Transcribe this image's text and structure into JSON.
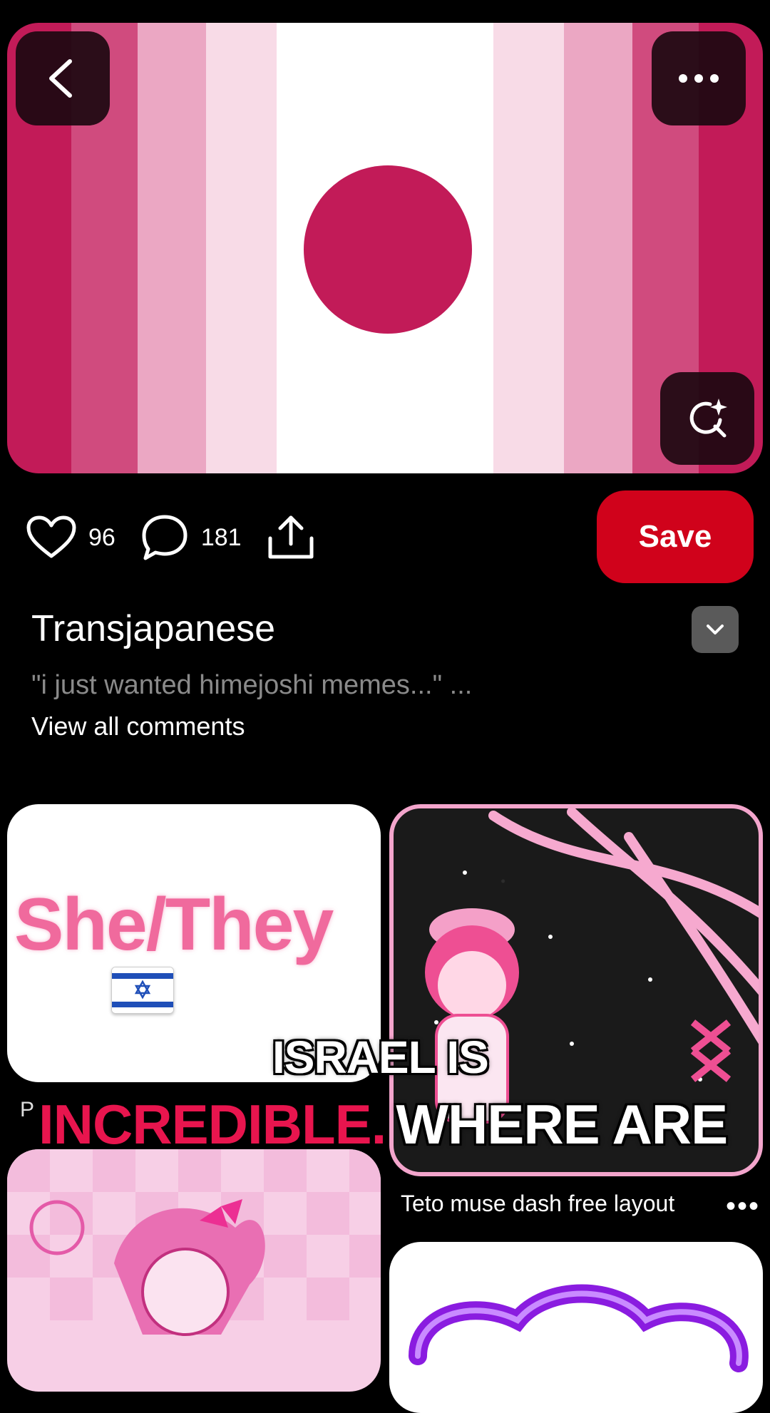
{
  "pin": {
    "title": "Transjapanese",
    "description": "\"i just wanted himejoshi memes...\" ...",
    "view_all_comments": "View all comments",
    "stripe_colors": [
      "#c21b58",
      "#d04b7e",
      "#eba7c3",
      "#f8dbe7",
      "#ffffff",
      "#f8dbe7",
      "#eba7c3",
      "#d04b7e",
      "#c21b58"
    ],
    "sun_color": "#c21b58"
  },
  "actions": {
    "likes": "96",
    "comments": "181",
    "save_label": "Save"
  },
  "icons": {
    "back": "chevron-left-icon",
    "more": "more-horizontal-icon",
    "visual_search": "visual-search-icon",
    "like": "heart-icon",
    "comment": "comment-icon",
    "share": "share-icon",
    "expand": "chevron-down-icon"
  },
  "grid": {
    "pin1_text": "She/They",
    "pin2_caption": "Teto muse dash free layout",
    "pin2_more": "•••",
    "pin_letter": "P"
  },
  "subtitles": {
    "line1": "ISRAEL IS",
    "line2_red": "INCREDIBLE.",
    "line2_white": "WHERE ARE"
  },
  "colors": {
    "accent": "#d0021b",
    "background": "#000000",
    "muted_text": "#8a8a8a"
  }
}
